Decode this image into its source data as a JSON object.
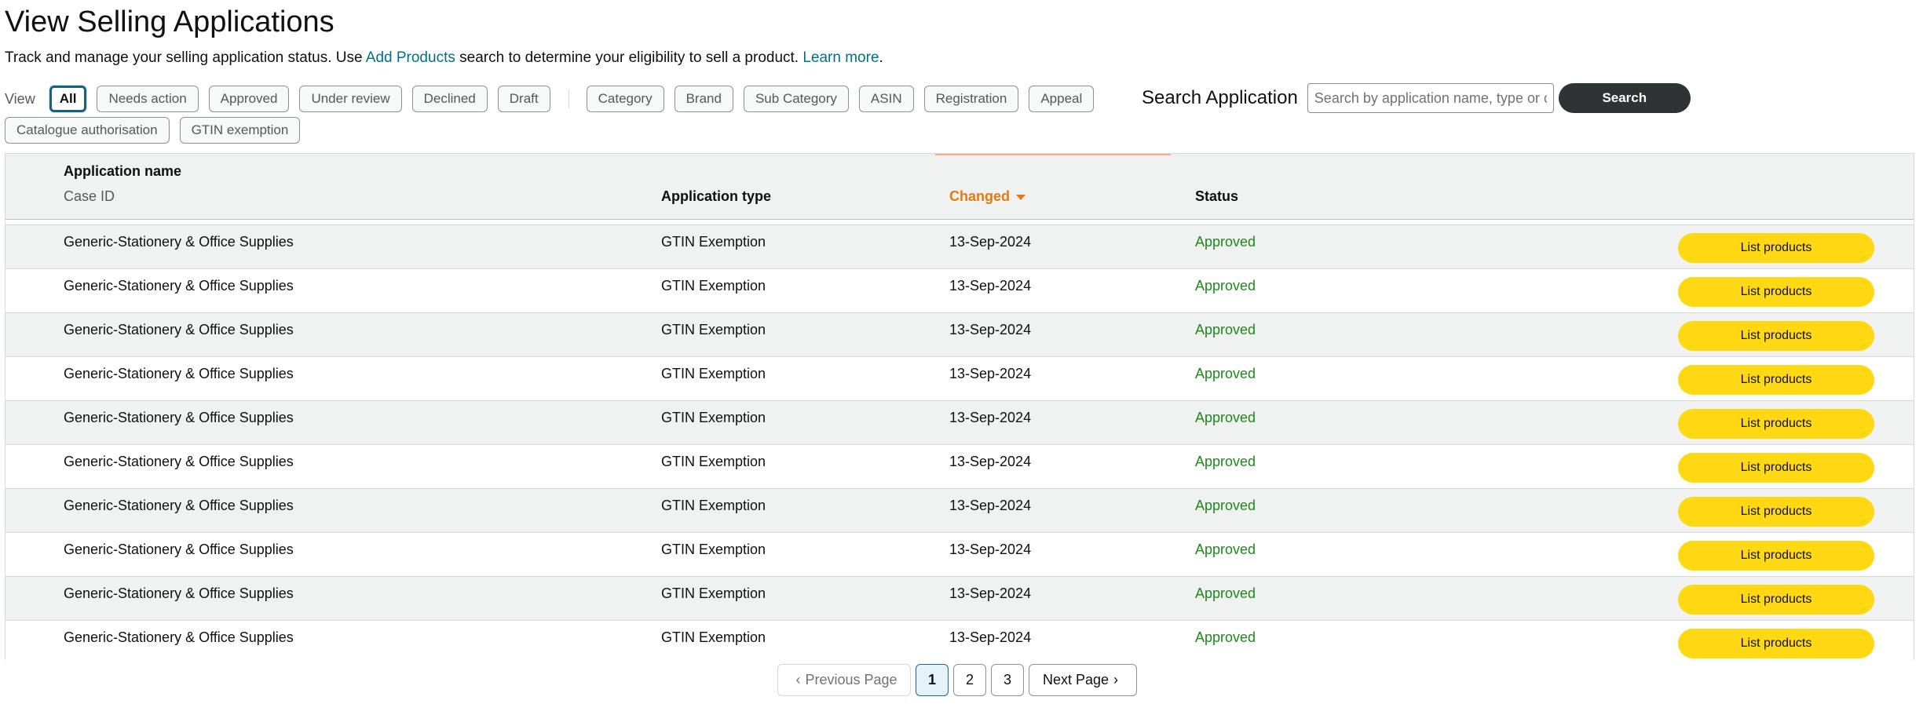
{
  "page": {
    "title": "View Selling Applications",
    "subtitle_before": "Track and manage your selling application status. Use ",
    "subtitle_link": "Add Products",
    "subtitle_after": " search to determine your eligibility to sell a product. ",
    "learn_more": "Learn more",
    "subtitle_end": "."
  },
  "filters": {
    "view_label": "View",
    "status_pills": [
      "All",
      "Needs action",
      "Approved",
      "Under review",
      "Declined",
      "Draft"
    ],
    "type_pills": [
      "Category",
      "Brand",
      "Sub Category",
      "ASIN",
      "Registration",
      "Appeal"
    ],
    "type_pills_row2": [
      "Catalogue authorisation",
      "GTIN exemption"
    ],
    "active": "All"
  },
  "search": {
    "label": "Search Application",
    "placeholder": "Search by application name, type or case ID",
    "button": "Search"
  },
  "table": {
    "headers": {
      "name": "Application name",
      "case_id": "Case ID",
      "type": "Application type",
      "changed": "Changed",
      "status": "Status"
    },
    "rows": [
      {
        "name": "Generic-Stationery & Office Supplies",
        "type": "GTIN Exemption",
        "changed": "13-Sep-2024",
        "status": "Approved",
        "action": "List products"
      },
      {
        "name": "Generic-Stationery & Office Supplies",
        "type": "GTIN Exemption",
        "changed": "13-Sep-2024",
        "status": "Approved",
        "action": "List products"
      },
      {
        "name": "Generic-Stationery & Office Supplies",
        "type": "GTIN Exemption",
        "changed": "13-Sep-2024",
        "status": "Approved",
        "action": "List products"
      },
      {
        "name": "Generic-Stationery & Office Supplies",
        "type": "GTIN Exemption",
        "changed": "13-Sep-2024",
        "status": "Approved",
        "action": "List products"
      },
      {
        "name": "Generic-Stationery & Office Supplies",
        "type": "GTIN Exemption",
        "changed": "13-Sep-2024",
        "status": "Approved",
        "action": "List products"
      },
      {
        "name": "Generic-Stationery & Office Supplies",
        "type": "GTIN Exemption",
        "changed": "13-Sep-2024",
        "status": "Approved",
        "action": "List products"
      },
      {
        "name": "Generic-Stationery & Office Supplies",
        "type": "GTIN Exemption",
        "changed": "13-Sep-2024",
        "status": "Approved",
        "action": "List products"
      },
      {
        "name": "Generic-Stationery & Office Supplies",
        "type": "GTIN Exemption",
        "changed": "13-Sep-2024",
        "status": "Approved",
        "action": "List products"
      },
      {
        "name": "Generic-Stationery & Office Supplies",
        "type": "GTIN Exemption",
        "changed": "13-Sep-2024",
        "status": "Approved",
        "action": "List products"
      },
      {
        "name": "Generic-Stationery & Office Supplies",
        "type": "GTIN Exemption",
        "changed": "13-Sep-2024",
        "status": "Approved",
        "action": "List products"
      }
    ]
  },
  "pagination": {
    "prev": "Previous Page",
    "pages": [
      "1",
      "2",
      "3"
    ],
    "current": "1",
    "next": "Next Page"
  },
  "colors": {
    "link": "#007185",
    "sort_active": "#e47911",
    "status_approved": "#1a8a1a",
    "primary_button": "#ffd814",
    "search_button": "#303333"
  }
}
